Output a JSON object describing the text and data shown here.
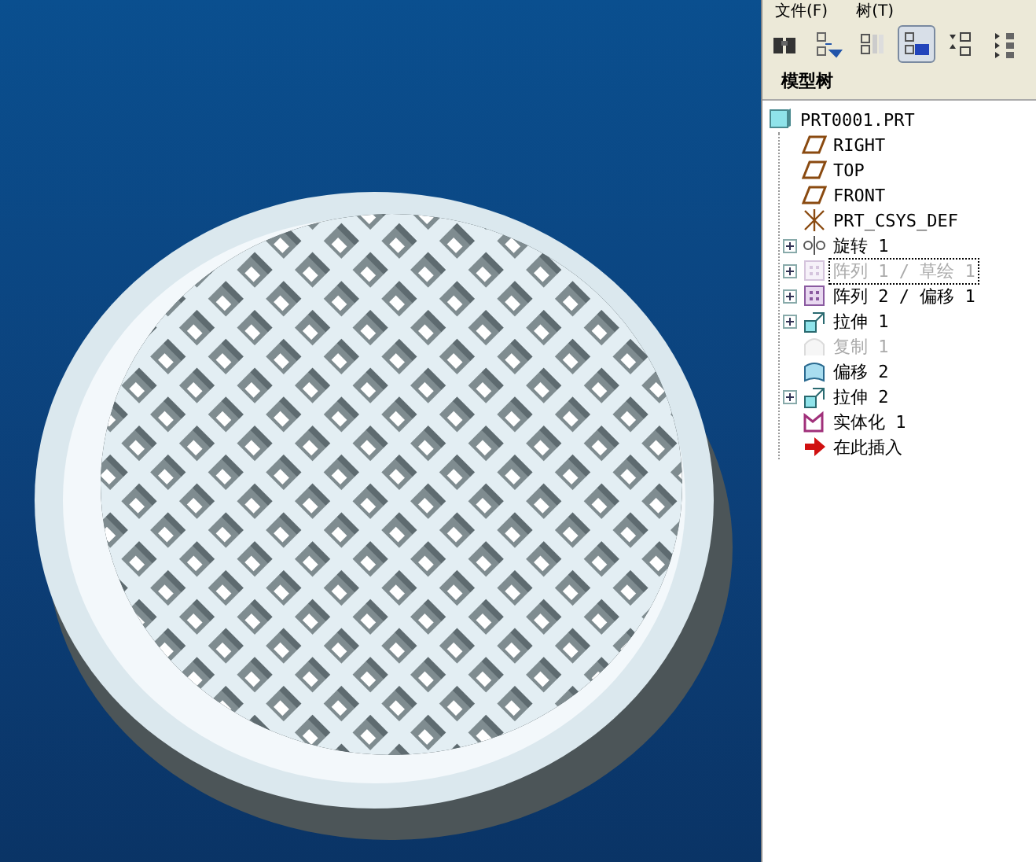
{
  "menu": [
    {
      "label": "文件(F)"
    },
    {
      "label": "树(T)"
    }
  ],
  "toolbar": [
    {
      "kind": "find",
      "selected": false
    },
    {
      "kind": "show-filter",
      "selected": false
    },
    {
      "kind": "columns",
      "selected": false
    },
    {
      "kind": "tree-layer",
      "selected": true
    },
    {
      "kind": "expand",
      "selected": false
    },
    {
      "kind": "collapse",
      "selected": false
    }
  ],
  "panel_title": "模型树",
  "tree": {
    "label": "PRT0001.PRT",
    "kind": "part",
    "children": [
      {
        "label": "RIGHT",
        "kind": "datum-plane",
        "collapsed": false,
        "disabled": false,
        "selected": false
      },
      {
        "label": "TOP",
        "kind": "datum-plane",
        "collapsed": false,
        "disabled": false,
        "selected": false
      },
      {
        "label": "FRONT",
        "kind": "datum-plane",
        "collapsed": false,
        "disabled": false,
        "selected": false
      },
      {
        "label": "PRT_CSYS_DEF",
        "kind": "csys",
        "collapsed": false,
        "disabled": false,
        "selected": false
      },
      {
        "label": "旋转 1",
        "kind": "revolve",
        "collapsed": true,
        "disabled": false,
        "selected": false
      },
      {
        "label": "阵列 1 / 草绘 1",
        "kind": "pattern",
        "collapsed": true,
        "disabled": true,
        "selected": true
      },
      {
        "label": "阵列 2 / 偏移 1",
        "kind": "pattern",
        "collapsed": true,
        "disabled": false,
        "selected": false
      },
      {
        "label": "拉伸 1",
        "kind": "extrude",
        "collapsed": true,
        "disabled": false,
        "selected": false
      },
      {
        "label": "复制 1",
        "kind": "copy",
        "collapsed": false,
        "disabled": true,
        "selected": false
      },
      {
        "label": "偏移 2",
        "kind": "offset",
        "collapsed": false,
        "disabled": false,
        "selected": false
      },
      {
        "label": "拉伸 2",
        "kind": "extrude",
        "collapsed": true,
        "disabled": false,
        "selected": false
      },
      {
        "label": "实体化 1",
        "kind": "solidify",
        "collapsed": false,
        "disabled": false,
        "selected": false
      },
      {
        "label": "在此插入",
        "kind": "insert",
        "collapsed": false,
        "disabled": false,
        "selected": false
      }
    ]
  }
}
